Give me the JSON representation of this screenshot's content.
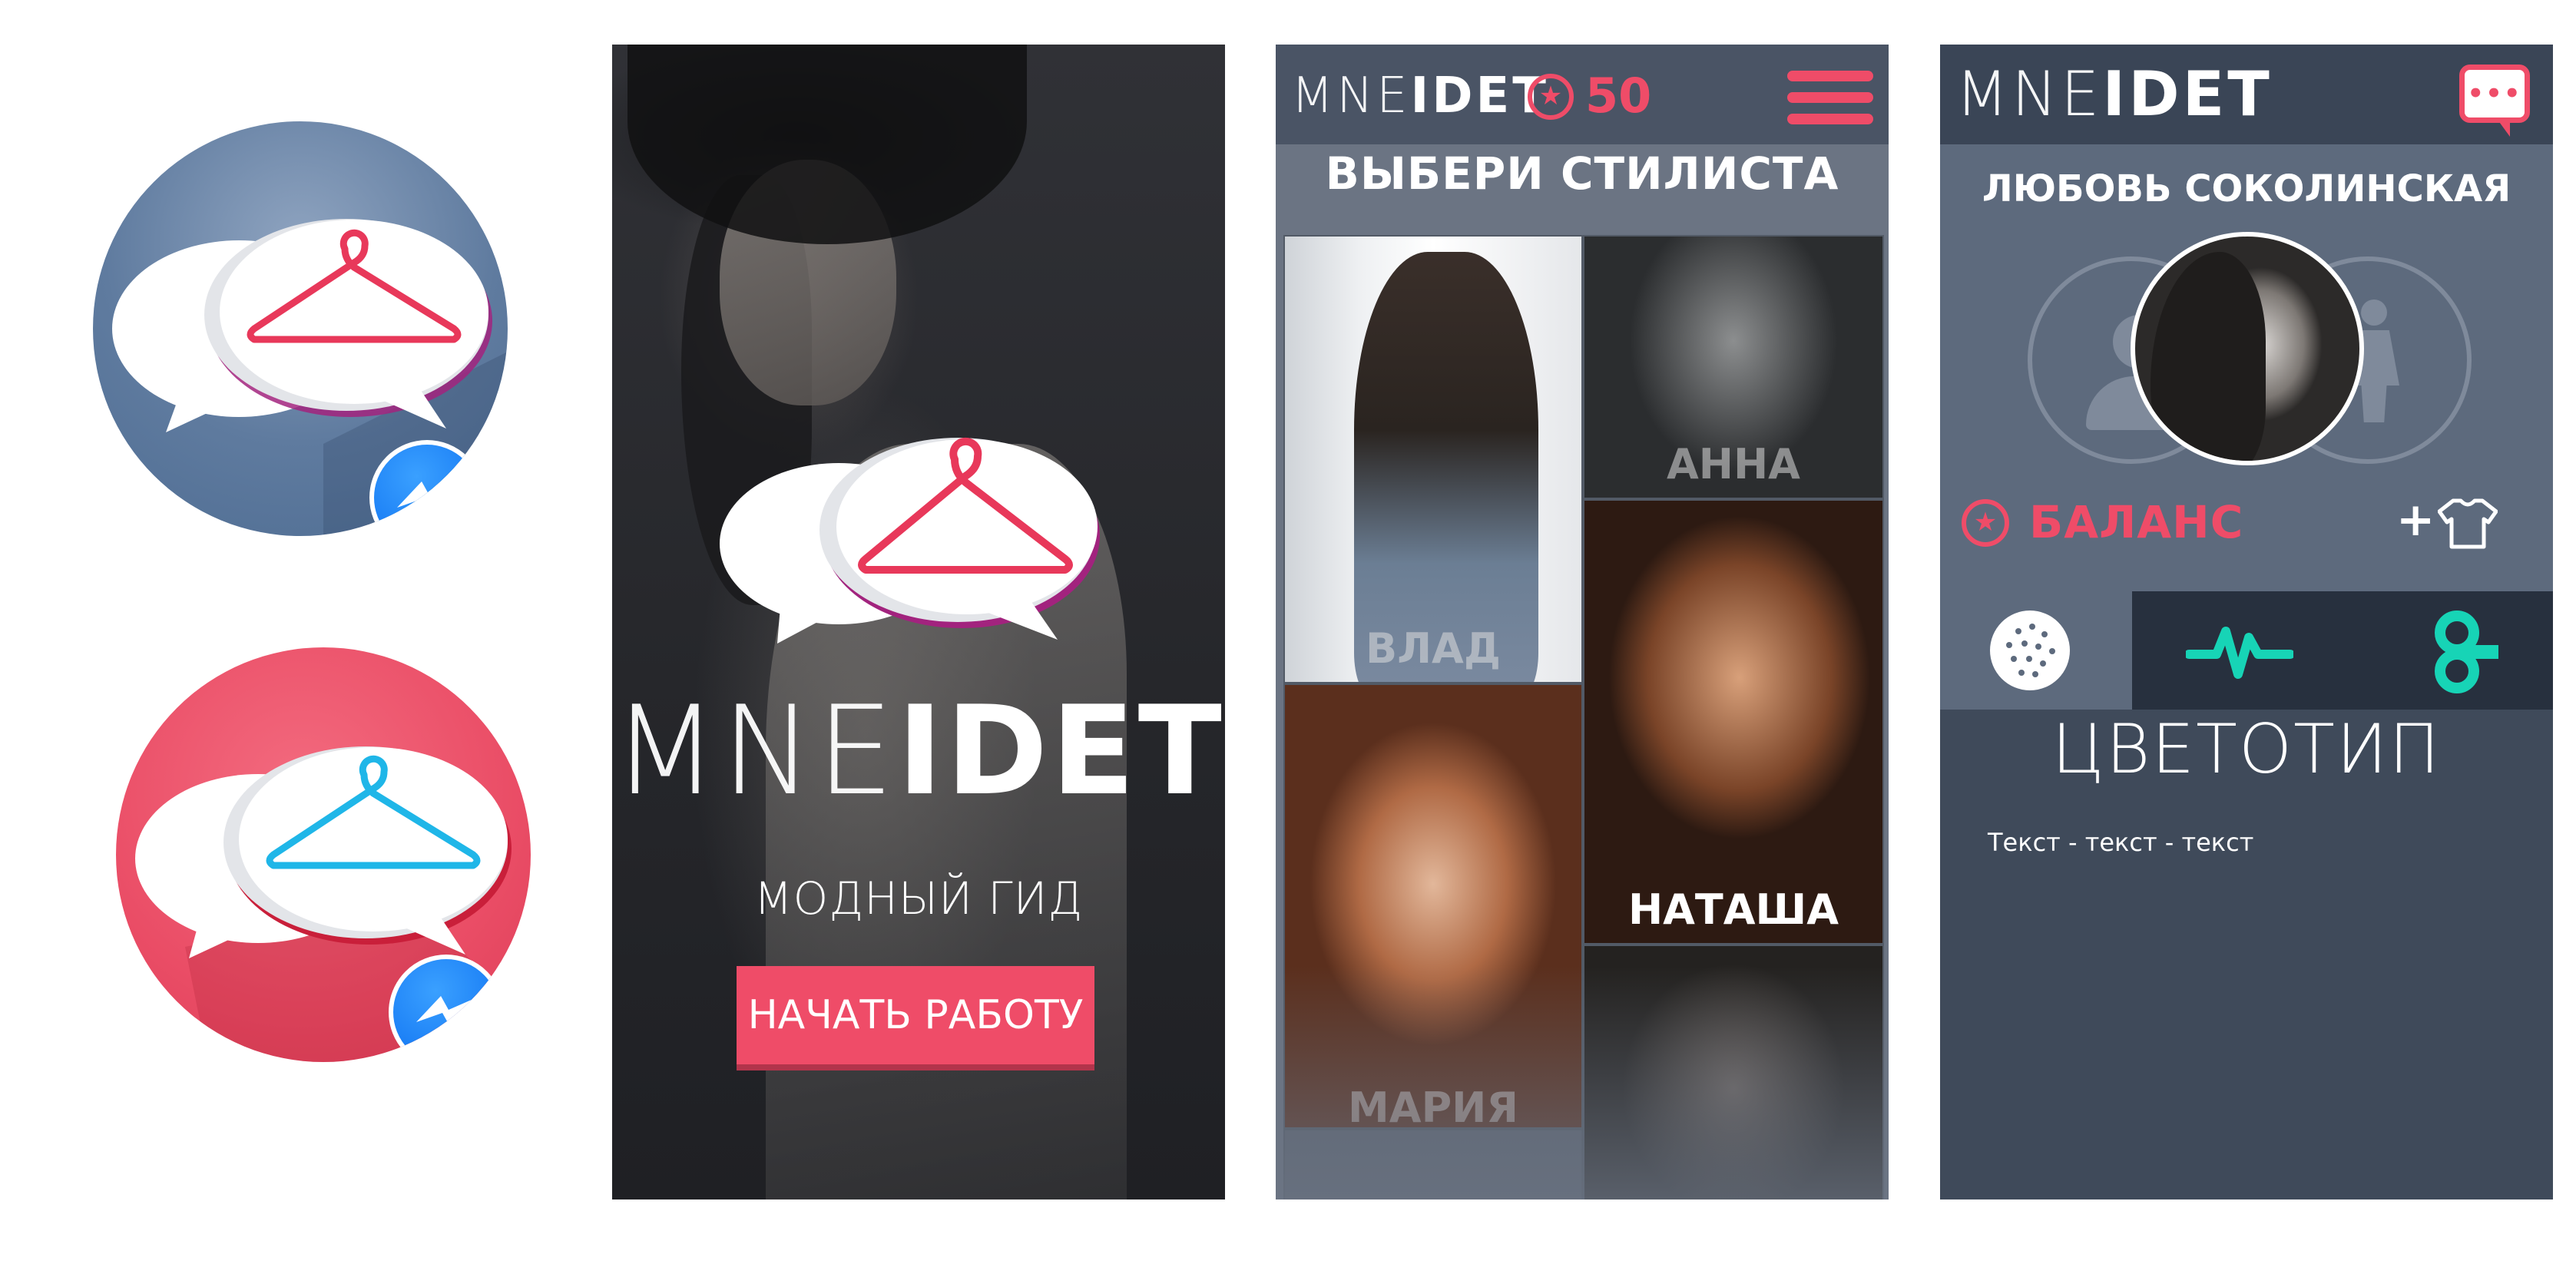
{
  "colors": {
    "accent": "#ef4c68",
    "icon_blue_bg": "#5f7b9f",
    "icon_pink_bg": "#ea4d66",
    "hanger_pink": "#e8385a",
    "hanger_blue": "#1fb6e8",
    "teal": "#17d4b6",
    "screen_dark": "#2a2b2f",
    "screen_slate": "#3f4a5a"
  },
  "icons": {
    "bubble": "speech-bubbles-icon",
    "hanger": "hanger-icon",
    "messenger": "messenger-bolt-icon"
  },
  "splash": {
    "brand_thin": "MNE",
    "brand_bold": "IDET",
    "subtitle": "МОДНЫЙ ГИД",
    "start_button": "НАЧАТЬ РАБОТУ"
  },
  "stylists": {
    "brand_thin": "MNE",
    "brand_bold": "IDET",
    "coins": "50",
    "title": "ВЫБЕРИ СТИЛИСТА",
    "items": [
      {
        "name": "ВЛАД"
      },
      {
        "name": "АННА"
      },
      {
        "name": "НАТАША"
      },
      {
        "name": "МАРИЯ"
      }
    ]
  },
  "profile": {
    "brand_thin": "MNE",
    "brand_bold": "IDET",
    "name": "ЛЮБОВЬ СОКОЛИНСКАЯ",
    "balance_label": "БАЛАНС",
    "plus": "+",
    "section_title": "ЦВЕТОТИП",
    "body_text": "Текст - текст - текст"
  }
}
